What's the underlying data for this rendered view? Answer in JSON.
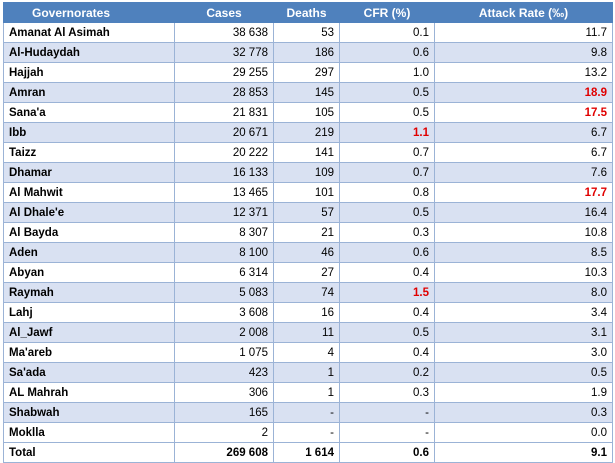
{
  "headers": [
    "Governorates",
    "Cases",
    "Deaths",
    "CFR (%)",
    "Attack Rate (‰)"
  ],
  "highlight_color": "#e00000",
  "header_color": "#4f81bd",
  "rows": [
    {
      "gov": "Amanat Al Asimah",
      "cases": "38 638",
      "deaths": "53",
      "cfr": "0.1",
      "ar": "11.7",
      "cfr_hl": false,
      "ar_hl": false
    },
    {
      "gov": "Al-Hudaydah",
      "cases": "32 778",
      "deaths": "186",
      "cfr": "0.6",
      "ar": "9.8",
      "cfr_hl": false,
      "ar_hl": false
    },
    {
      "gov": "Hajjah",
      "cases": "29 255",
      "deaths": "297",
      "cfr": "1.0",
      "ar": "13.2",
      "cfr_hl": false,
      "ar_hl": false
    },
    {
      "gov": "Amran",
      "cases": "28 853",
      "deaths": "145",
      "cfr": "0.5",
      "ar": "18.9",
      "cfr_hl": false,
      "ar_hl": true
    },
    {
      "gov": "Sana'a",
      "cases": "21 831",
      "deaths": "105",
      "cfr": "0.5",
      "ar": "17.5",
      "cfr_hl": false,
      "ar_hl": true
    },
    {
      "gov": "Ibb",
      "cases": "20 671",
      "deaths": "219",
      "cfr": "1.1",
      "ar": "6.7",
      "cfr_hl": true,
      "ar_hl": false
    },
    {
      "gov": "Taizz",
      "cases": "20 222",
      "deaths": "141",
      "cfr": "0.7",
      "ar": "6.7",
      "cfr_hl": false,
      "ar_hl": false
    },
    {
      "gov": "Dhamar",
      "cases": "16 133",
      "deaths": "109",
      "cfr": "0.7",
      "ar": "7.6",
      "cfr_hl": false,
      "ar_hl": false
    },
    {
      "gov": "Al Mahwit",
      "cases": "13 465",
      "deaths": "101",
      "cfr": "0.8",
      "ar": "17.7",
      "cfr_hl": false,
      "ar_hl": true
    },
    {
      "gov": "Al Dhale'e",
      "cases": "12 371",
      "deaths": "57",
      "cfr": "0.5",
      "ar": "16.4",
      "cfr_hl": false,
      "ar_hl": false
    },
    {
      "gov": "Al Bayda",
      "cases": "8 307",
      "deaths": "21",
      "cfr": "0.3",
      "ar": "10.8",
      "cfr_hl": false,
      "ar_hl": false
    },
    {
      "gov": "Aden",
      "cases": "8 100",
      "deaths": "46",
      "cfr": "0.6",
      "ar": "8.5",
      "cfr_hl": false,
      "ar_hl": false
    },
    {
      "gov": "Abyan",
      "cases": "6 314",
      "deaths": "27",
      "cfr": "0.4",
      "ar": "10.3",
      "cfr_hl": false,
      "ar_hl": false
    },
    {
      "gov": "Raymah",
      "cases": "5 083",
      "deaths": "74",
      "cfr": "1.5",
      "ar": "8.0",
      "cfr_hl": true,
      "ar_hl": false
    },
    {
      "gov": "Lahj",
      "cases": "3 608",
      "deaths": "16",
      "cfr": "0.4",
      "ar": "3.4",
      "cfr_hl": false,
      "ar_hl": false
    },
    {
      "gov": "Al_Jawf",
      "cases": "2 008",
      "deaths": "11",
      "cfr": "0.5",
      "ar": "3.1",
      "cfr_hl": false,
      "ar_hl": false
    },
    {
      "gov": "Ma'areb",
      "cases": "1 075",
      "deaths": "4",
      "cfr": "0.4",
      "ar": "3.0",
      "cfr_hl": false,
      "ar_hl": false
    },
    {
      "gov": "Sa'ada",
      "cases": "423",
      "deaths": "1",
      "cfr": "0.2",
      "ar": "0.5",
      "cfr_hl": false,
      "ar_hl": false
    },
    {
      "gov": "AL Mahrah",
      "cases": "306",
      "deaths": "1",
      "cfr": "0.3",
      "ar": "1.9",
      "cfr_hl": false,
      "ar_hl": false
    },
    {
      "gov": "Shabwah",
      "cases": "165",
      "deaths": "-",
      "cfr": "-",
      "ar": "0.3",
      "cfr_hl": false,
      "ar_hl": false
    },
    {
      "gov": "Moklla",
      "cases": "2",
      "deaths": "-",
      "cfr": "-",
      "ar": "0.0",
      "cfr_hl": false,
      "ar_hl": false
    }
  ],
  "total": {
    "gov": "Total",
    "cases": "269 608",
    "deaths": "1 614",
    "cfr": "0.6",
    "ar": "9.1"
  }
}
